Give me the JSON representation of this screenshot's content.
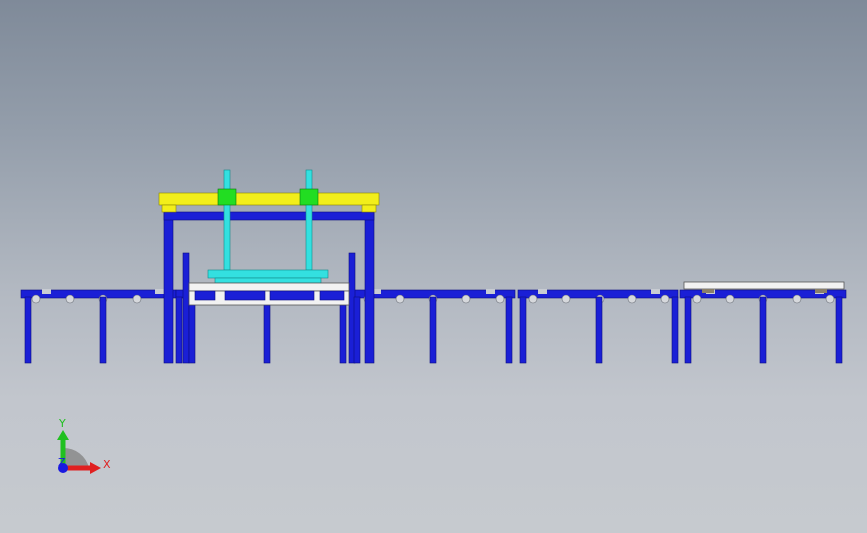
{
  "view": {
    "background_top": "#7f8a99",
    "background_bottom": "#c6cacf"
  },
  "model": {
    "frame_color": "#1a1fd6",
    "frame_edge": "#0a0d80",
    "gantry_beam_color": "#f2ee1a",
    "carriage_color": "#22dd22",
    "lifter_color": "#33e0e0",
    "pallet_color": "#f2f2f2",
    "roller_color": "#d6d8dc"
  },
  "triad": {
    "x_label": "X",
    "y_label": "Y",
    "z_label": "Z",
    "x_color": "#e02020",
    "y_color": "#20c020",
    "z_color": "#1a1ae0"
  }
}
